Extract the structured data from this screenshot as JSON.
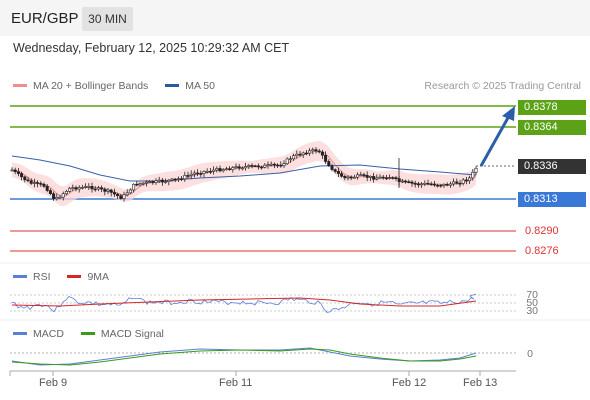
{
  "header": {
    "symbol": "EUR/GBP",
    "timeframe_button": "30 MIN"
  },
  "datetime": "Wednesday, February 12, 2025 10:29:32 AM CET",
  "legend_main": [
    {
      "label": "MA 20 + Bollinger Bands",
      "color": "#f08c8c"
    },
    {
      "label": "MA 50",
      "color": "#2b5a9c"
    }
  ],
  "credit": "Research © 2025 Trading Central",
  "levels": {
    "resistance_2": "0.8378",
    "resistance_1": "0.8364",
    "current_price": "0.8336",
    "pivot": "0.8313",
    "support_1": "0.8290",
    "support_2": "0.8276"
  },
  "colors": {
    "resistance": "#5ba217",
    "pivot": "#3a78d8",
    "support": "#dc3232",
    "current": "#333333",
    "arrow": "#2a5ea8",
    "ma20": "#f08c8c",
    "ma50": "#3a5fa8"
  },
  "legend_rsi": [
    {
      "label": "RSI",
      "color": "#5a7fd8"
    },
    {
      "label": "9MA",
      "color": "#d62728"
    }
  ],
  "rsi_levels": [
    "70",
    "50",
    "30"
  ],
  "legend_macd": [
    {
      "label": "MACD",
      "color": "#5a7fd8"
    },
    {
      "label": "MACD Signal",
      "color": "#3a9a1a"
    }
  ],
  "macd_zero": "0",
  "x_axis": [
    "Feb 9",
    "Feb 11",
    "Feb 12",
    "Feb 13"
  ]
}
